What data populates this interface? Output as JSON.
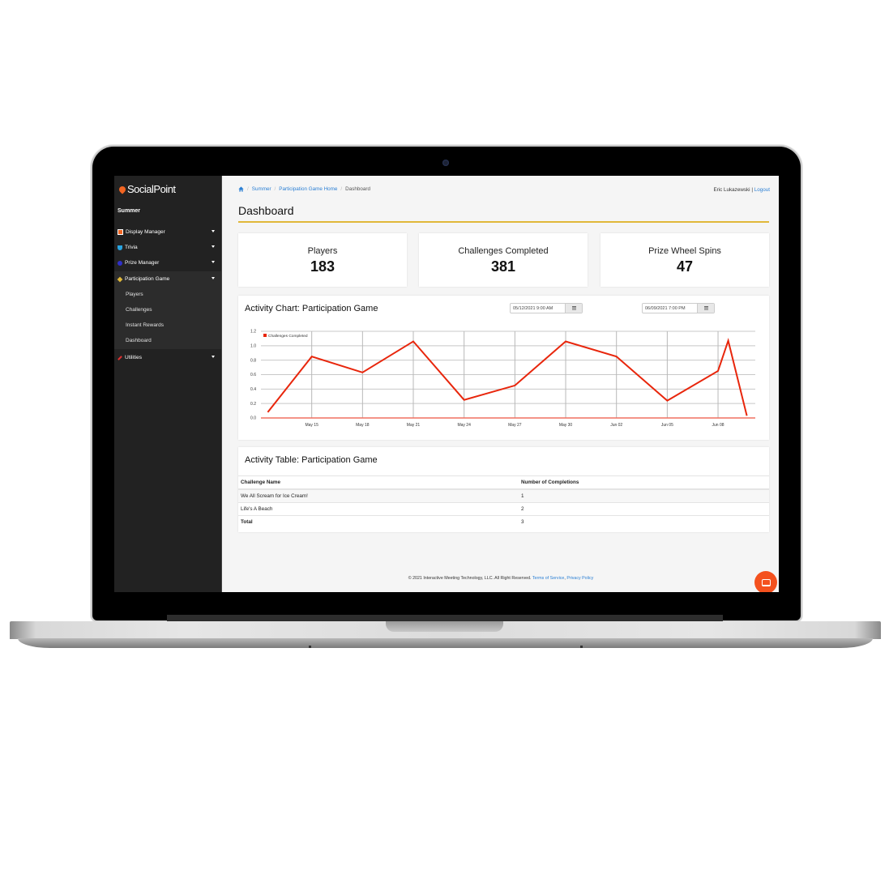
{
  "app": {
    "logo_text": "SocialPoint",
    "event_name": "Summer"
  },
  "sidebar": {
    "items": [
      {
        "label": "Display Manager",
        "icon": "image-icon",
        "color": "#f26522"
      },
      {
        "label": "Trivia",
        "icon": "trophy-icon",
        "color": "#29a3e0"
      },
      {
        "label": "Prize Manager",
        "icon": "circle-icon",
        "color": "#3030c8"
      },
      {
        "label": "Participation Game",
        "icon": "puzzle-icon",
        "color": "#e0b83a"
      },
      {
        "label": "Utilities",
        "icon": "wrench-icon",
        "color": "#e03030"
      }
    ],
    "subitems": [
      {
        "label": "Players"
      },
      {
        "label": "Challenges"
      },
      {
        "label": "Instant Rewards"
      },
      {
        "label": "Dashboard"
      }
    ]
  },
  "breadcrumb": {
    "items": [
      "Summer",
      "Participation Game Home"
    ],
    "current": "Dashboard"
  },
  "user": {
    "name": "Eric Lukazewski",
    "separator": " | ",
    "logout": "Logout"
  },
  "page": {
    "title": "Dashboard"
  },
  "stats": [
    {
      "label": "Players",
      "value": "183"
    },
    {
      "label": "Challenges Completed",
      "value": "381"
    },
    {
      "label": "Prize Wheel Spins",
      "value": "47"
    }
  ],
  "activity_chart": {
    "title": "Activity Chart: Participation Game",
    "start_date": "05/12/2021 9:00 AM",
    "end_date": "06/09/2021 7:00 PM"
  },
  "chart_data": {
    "type": "line",
    "title": "Activity Chart: Participation Game",
    "xlabel": "",
    "ylabel": "",
    "legend": [
      "Challenges Completed"
    ],
    "legend_position": "top-left",
    "grid": true,
    "ylim": [
      0,
      1.2
    ],
    "yticks": [
      "0.0",
      "0.2",
      "0.4",
      "0.6",
      "0.8",
      "1.0",
      "1.2"
    ],
    "xticks": [
      {
        "label": "May 15",
        "day": 3
      },
      {
        "label": "May 18",
        "day": 6
      },
      {
        "label": "May 21",
        "day": 9
      },
      {
        "label": "May 24",
        "day": 12
      },
      {
        "label": "May 27",
        "day": 15
      },
      {
        "label": "May 30",
        "day": 18
      },
      {
        "label": "Jun 02",
        "day": 21
      },
      {
        "label": "Jun 05",
        "day": 24
      },
      {
        "label": "Jun 08",
        "day": 27
      }
    ],
    "x_range_days": [
      0,
      29.2
    ],
    "series": [
      {
        "name": "Challenges Completed",
        "color": "#e8260c",
        "points": [
          {
            "day": 0.4,
            "value": 0.08
          },
          {
            "day": 3,
            "value": 0.85
          },
          {
            "day": 6,
            "value": 0.63
          },
          {
            "day": 9,
            "value": 1.06
          },
          {
            "day": 12,
            "value": 0.25
          },
          {
            "day": 15,
            "value": 0.45
          },
          {
            "day": 18,
            "value": 1.06
          },
          {
            "day": 21,
            "value": 0.85
          },
          {
            "day": 24,
            "value": 0.24
          },
          {
            "day": 27,
            "value": 0.65
          },
          {
            "day": 27.6,
            "value": 1.07
          },
          {
            "day": 28.7,
            "value": 0.03
          }
        ]
      }
    ]
  },
  "activity_table": {
    "title": "Activity Table: Participation Game",
    "columns": [
      "Challenge Name",
      "Number of Completions"
    ],
    "rows": [
      [
        "We All Scream for Ice Cream!",
        "1"
      ],
      [
        "Life's A Beach",
        "2"
      ]
    ],
    "total": [
      "Total",
      "3"
    ]
  },
  "footer": {
    "copyright": "© 2021 Interactive Meeting Technology, LLC. All Right Reserved.",
    "terms": "Terms of Service",
    "privacy": "Privacy Policy"
  }
}
